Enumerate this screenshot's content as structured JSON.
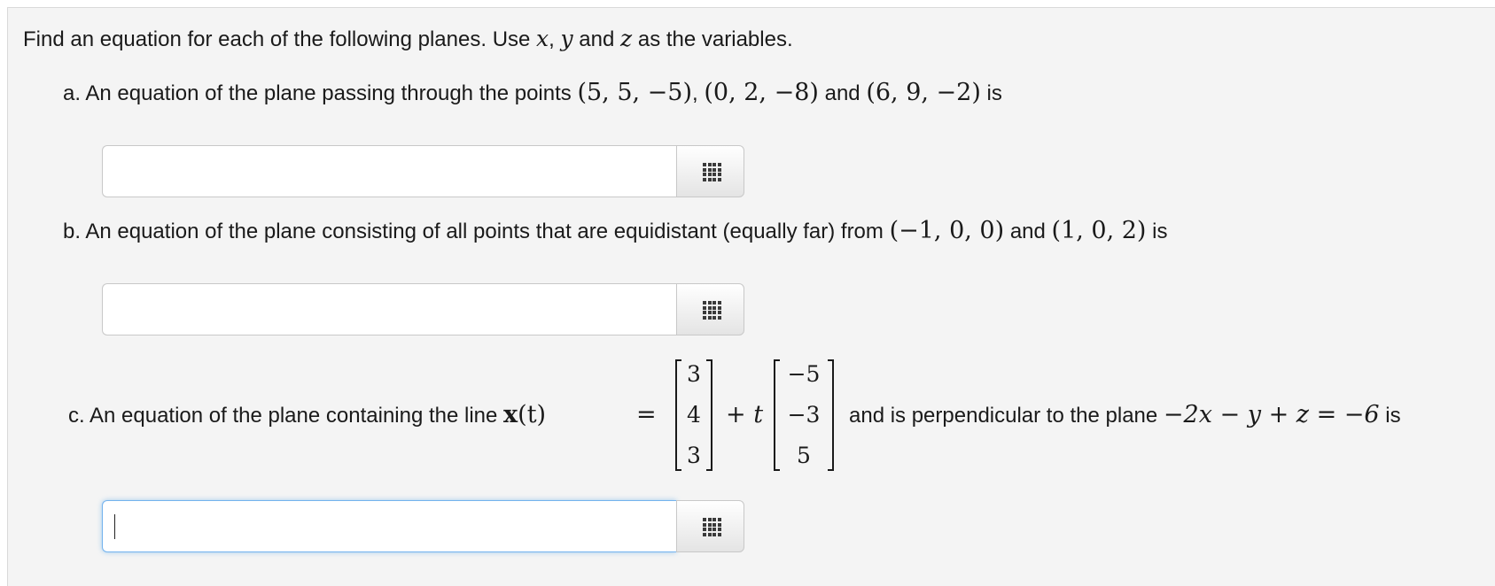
{
  "instructions": {
    "prefix": "Find an equation for each of the following planes. Use",
    "var_x": "x",
    "comma": ",",
    "var_y": "y",
    "and_text": "and",
    "var_z": "z",
    "suffix": "as the variables."
  },
  "part_a": {
    "prefix": "a. An equation of the plane passing through the points",
    "point1": "(5, 5, −5)",
    "sep1": ",",
    "point2": "(0, 2, −8)",
    "and_text": "and",
    "point3": "(6, 9, −2)",
    "suffix": "is",
    "answer_value": ""
  },
  "part_b": {
    "prefix": "b. An equation of the plane consisting of all points that are equidistant (equally far) from",
    "point1": "(−1, 0, 0)",
    "and_text": "and",
    "point2": "(1, 0, 2)",
    "suffix": "is",
    "answer_value": ""
  },
  "part_c": {
    "prefix": "c. An equation of the plane containing the line",
    "line_func": "x",
    "line_arg": "(t)",
    "equals": "=",
    "plus": "+",
    "param": "t",
    "vector1": [
      "3",
      "4",
      "3"
    ],
    "vector2": [
      "−5",
      "−3",
      "5"
    ],
    "middle_text": "and is perpendicular to the plane",
    "plane_eq": "−2x − y + z = −6",
    "suffix": "is",
    "answer_value": ""
  },
  "colors": {
    "panel_background": "#f4f4f4",
    "focus_border": "#74b3ee"
  },
  "icons": {
    "answer_button": "grid-icon"
  }
}
